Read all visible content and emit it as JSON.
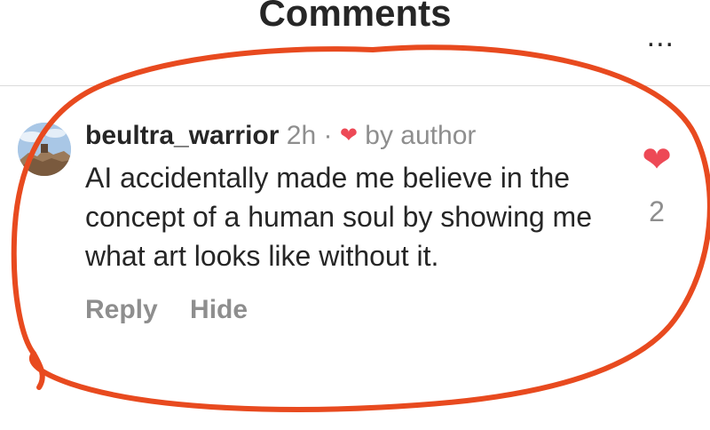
{
  "header": {
    "title": "Comments",
    "more_label": "..."
  },
  "comment": {
    "username": "beultra_warrior",
    "time": "2h",
    "separator": "·",
    "liked_by": "by author",
    "text": "AI accidentally made me believe in the concept of a human soul by showing me what art looks like without it.",
    "reply_label": "Reply",
    "hide_label": "Hide",
    "like_count": "2"
  },
  "colors": {
    "heart": "#ed4956",
    "annotation": "#e84a1f",
    "muted": "#8e8e8e"
  },
  "icons": {
    "more": "more-options-icon",
    "author_like": "heart-icon",
    "like": "heart-icon"
  }
}
